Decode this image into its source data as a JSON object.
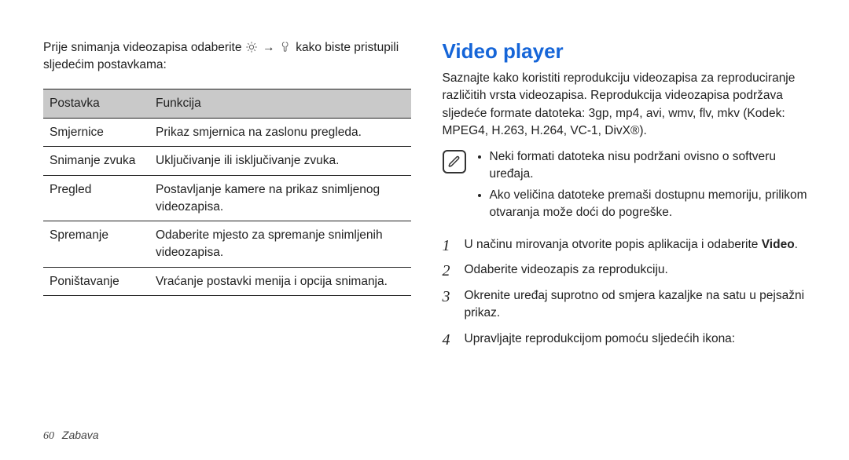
{
  "leftColumn": {
    "introPrefix": "Prije snimanja videozapisa odaberite ",
    "introArrow": "→",
    "introSuffix": " kako biste pristupili sljedećim postavkama:",
    "tableHeaders": {
      "setting": "Postavka",
      "function": "Funkcija"
    },
    "rows": [
      {
        "setting": "Smjernice",
        "function": "Prikaz smjernica na zaslonu pregleda."
      },
      {
        "setting": "Snimanje zvuka",
        "function": "Uključivanje ili isključivanje zvuka."
      },
      {
        "setting": "Pregled",
        "function": "Postavljanje kamere na prikaz snimljenog videozapisa."
      },
      {
        "setting": "Spremanje",
        "function": "Odaberite mjesto za spremanje snimljenih videozapisa."
      },
      {
        "setting": "Poništavanje",
        "function": "Vraćanje postavki menija i opcija snimanja."
      }
    ]
  },
  "rightColumn": {
    "title": "Video player",
    "intro": "Saznajte kako koristiti reprodukciju videozapisa za reproduciranje različitih vrsta videozapisa. Reprodukcija videozapisa podržava sljedeće formate datoteka: 3gp, mp4, avi, wmv, flv, mkv (Kodek: MPEG4, H.263, H.264, VC-1, DivX®).",
    "notes": [
      "Neki formati datoteka nisu podržani ovisno o softveru uređaja.",
      "Ako veličina datoteke premaši dostupnu memoriju, prilikom otvaranja može doći do pogreške."
    ],
    "steps": [
      {
        "textBefore": "U načinu mirovanja otvorite popis aplikacija i odaberite ",
        "bold": "Video",
        "textAfter": "."
      },
      {
        "textBefore": "Odaberite videozapis za reprodukciju.",
        "bold": "",
        "textAfter": ""
      },
      {
        "textBefore": "Okrenite uređaj suprotno od smjera kazaljke na satu u pejsažni prikaz.",
        "bold": "",
        "textAfter": ""
      },
      {
        "textBefore": "Upravljajte reprodukcijom pomoću sljedećih ikona:",
        "bold": "",
        "textAfter": ""
      }
    ]
  },
  "footer": {
    "pageNumber": "60",
    "section": "Zabava"
  }
}
